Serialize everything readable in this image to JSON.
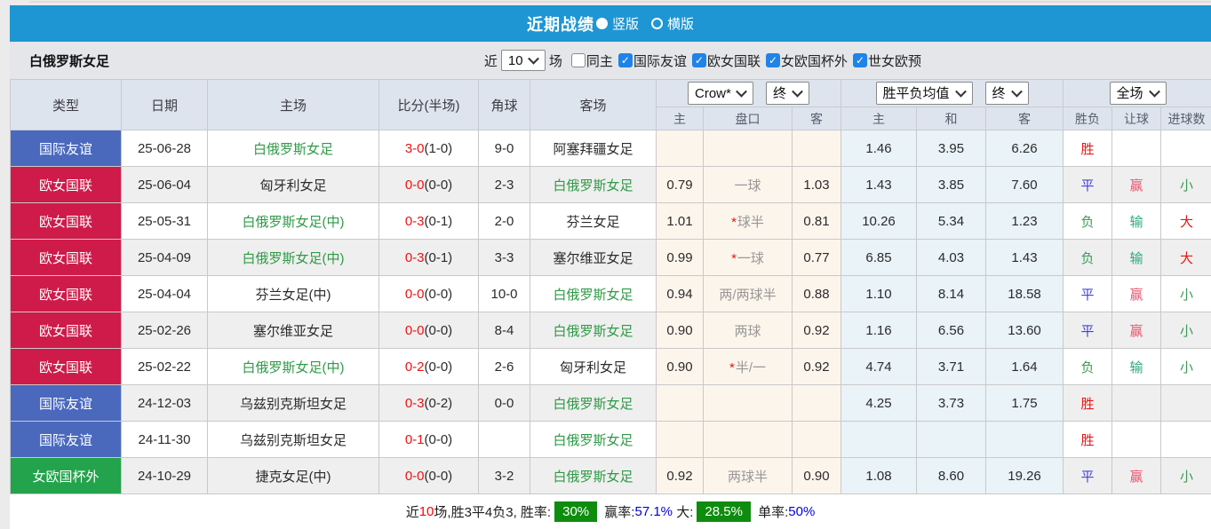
{
  "title": {
    "heading": "近期战绩",
    "radio_vertical": "竖版",
    "radio_horizontal": "横版",
    "vertical_selected": true
  },
  "team_bar": {
    "team_name": "白俄罗斯女足",
    "recent_label": "近",
    "recent_count": "10",
    "matches_label": "场",
    "checkboxes": [
      {
        "label": "同主",
        "checked": false
      },
      {
        "label": "国际友谊",
        "checked": true
      },
      {
        "label": "欧女国联",
        "checked": true
      },
      {
        "label": "女欧国杯外",
        "checked": true
      },
      {
        "label": "世女欧预",
        "checked": true
      }
    ]
  },
  "table": {
    "headers": {
      "type": "类型",
      "date": "日期",
      "home": "主场",
      "score": "比分(半场)",
      "corner": "角球",
      "away": "客场",
      "bookmaker_select": "Crow*",
      "bookmaker_time_select": "终",
      "avg_select": "胜平负均值",
      "avg_time_select": "终",
      "scope_select": "全场",
      "sub": [
        "主",
        "盘口",
        "客",
        "主",
        "和",
        "客",
        "胜负",
        "让球",
        "进球数"
      ]
    },
    "rows": [
      {
        "type": "国际友谊",
        "type_color": "blue",
        "date": "25-06-28",
        "home": "白俄罗斯女足",
        "home_green": true,
        "score": "3-0",
        "half": "(1-0)",
        "corner": "9-0",
        "away": "阿塞拜疆女足",
        "away_green": false,
        "crow_home": "",
        "handicap": "",
        "handicap_star": false,
        "crow_away": "",
        "avg_home": "1.46",
        "avg_draw": "3.95",
        "avg_away": "6.26",
        "outcome": "胜",
        "handicap_result": "",
        "goals": ""
      },
      {
        "type": "欧女国联",
        "type_color": "red",
        "date": "25-06-04",
        "home": "匈牙利女足",
        "home_green": false,
        "score": "0-0",
        "half": "(0-0)",
        "corner": "2-3",
        "away": "白俄罗斯女足",
        "away_green": true,
        "crow_home": "0.79",
        "handicap": "一球",
        "handicap_star": false,
        "crow_away": "1.03",
        "avg_home": "1.43",
        "avg_draw": "3.85",
        "avg_away": "7.60",
        "outcome": "平",
        "handicap_result": "赢",
        "goals": "小"
      },
      {
        "type": "欧女国联",
        "type_color": "red",
        "date": "25-05-31",
        "home": "白俄罗斯女足(中)",
        "home_green": true,
        "score": "0-3",
        "half": "(0-1)",
        "corner": "2-0",
        "away": "芬兰女足",
        "away_green": false,
        "crow_home": "1.01",
        "handicap": "球半",
        "handicap_star": true,
        "crow_away": "0.81",
        "avg_home": "10.26",
        "avg_draw": "5.34",
        "avg_away": "1.23",
        "outcome": "负",
        "handicap_result": "输",
        "goals": "大"
      },
      {
        "type": "欧女国联",
        "type_color": "red",
        "date": "25-04-09",
        "home": "白俄罗斯女足(中)",
        "home_green": true,
        "score": "0-3",
        "half": "(0-1)",
        "corner": "3-3",
        "away": "塞尔维亚女足",
        "away_green": false,
        "crow_home": "0.99",
        "handicap": "一球",
        "handicap_star": true,
        "crow_away": "0.77",
        "avg_home": "6.85",
        "avg_draw": "4.03",
        "avg_away": "1.43",
        "outcome": "负",
        "handicap_result": "输",
        "goals": "大"
      },
      {
        "type": "欧女国联",
        "type_color": "red",
        "date": "25-04-04",
        "home": "芬兰女足(中)",
        "home_green": false,
        "score": "0-0",
        "half": "(0-0)",
        "corner": "10-0",
        "away": "白俄罗斯女足",
        "away_green": true,
        "crow_home": "0.94",
        "handicap": "两/两球半",
        "handicap_star": false,
        "crow_away": "0.88",
        "avg_home": "1.10",
        "avg_draw": "8.14",
        "avg_away": "18.58",
        "outcome": "平",
        "handicap_result": "赢",
        "goals": "小"
      },
      {
        "type": "欧女国联",
        "type_color": "red",
        "date": "25-02-26",
        "home": "塞尔维亚女足",
        "home_green": false,
        "score": "0-0",
        "half": "(0-0)",
        "corner": "8-4",
        "away": "白俄罗斯女足",
        "away_green": true,
        "crow_home": "0.90",
        "handicap": "两球",
        "handicap_star": false,
        "crow_away": "0.92",
        "avg_home": "1.16",
        "avg_draw": "6.56",
        "avg_away": "13.60",
        "outcome": "平",
        "handicap_result": "赢",
        "goals": "小"
      },
      {
        "type": "欧女国联",
        "type_color": "red",
        "date": "25-02-22",
        "home": "白俄罗斯女足(中)",
        "home_green": true,
        "score": "0-2",
        "half": "(0-0)",
        "corner": "2-6",
        "away": "匈牙利女足",
        "away_green": false,
        "crow_home": "0.90",
        "handicap": "半/一",
        "handicap_star": true,
        "crow_away": "0.92",
        "avg_home": "4.74",
        "avg_draw": "3.71",
        "avg_away": "1.64",
        "outcome": "负",
        "handicap_result": "输",
        "goals": "小"
      },
      {
        "type": "国际友谊",
        "type_color": "blue",
        "date": "24-12-03",
        "home": "乌兹别克斯坦女足",
        "home_green": false,
        "score": "0-3",
        "half": "(0-2)",
        "corner": "0-0",
        "away": "白俄罗斯女足",
        "away_green": true,
        "crow_home": "",
        "handicap": "",
        "handicap_star": false,
        "crow_away": "",
        "avg_home": "4.25",
        "avg_draw": "3.73",
        "avg_away": "1.75",
        "outcome": "胜",
        "handicap_result": "",
        "goals": ""
      },
      {
        "type": "国际友谊",
        "type_color": "blue",
        "date": "24-11-30",
        "home": "乌兹别克斯坦女足",
        "home_green": false,
        "score": "0-1",
        "half": "(0-0)",
        "corner": "",
        "away": "白俄罗斯女足",
        "away_green": true,
        "crow_home": "",
        "handicap": "",
        "handicap_star": false,
        "crow_away": "",
        "avg_home": "",
        "avg_draw": "",
        "avg_away": "",
        "outcome": "胜",
        "handicap_result": "",
        "goals": ""
      },
      {
        "type": "女欧国杯外",
        "type_color": "green",
        "date": "24-10-29",
        "home": "捷克女足(中)",
        "home_green": false,
        "score": "0-0",
        "half": "(0-0)",
        "corner": "3-2",
        "away": "白俄罗斯女足",
        "away_green": true,
        "crow_home": "0.92",
        "handicap": "两球半",
        "handicap_star": false,
        "crow_away": "0.90",
        "avg_home": "1.08",
        "avg_draw": "8.60",
        "avg_away": "19.26",
        "outcome": "平",
        "handicap_result": "赢",
        "goals": "小"
      }
    ]
  },
  "summary": {
    "segments": [
      {
        "text": "近",
        "style": "plain"
      },
      {
        "text": "10",
        "style": "red"
      },
      {
        "text": "场,胜3平4负3, 胜率:",
        "style": "plain"
      },
      {
        "text": "30%",
        "style": "badge"
      },
      {
        "text": " 赢率:",
        "style": "plain"
      },
      {
        "text": "57.1%",
        "style": "blue"
      },
      {
        "text": " 大:",
        "style": "plain"
      },
      {
        "text": "28.5%",
        "style": "badge"
      },
      {
        "text": " 单率:",
        "style": "plain"
      },
      {
        "text": "50%",
        "style": "blue"
      }
    ]
  },
  "colors": {
    "title_bar": "#1e96d3",
    "badge_friendly_blue": "#4a69bd",
    "badge_league_red": "#ce1b4a",
    "badge_cup_green": "#23a34b",
    "team_green": "#2e9a46",
    "score_red": "#ee1111",
    "odds_cream_bg": "#fcf5ec",
    "avg_blue_bg": "#e9f3f8",
    "summary_badge_green": "#0e8c0e",
    "summary_blue": "#0000dd",
    "checkbox_blue": "#1f83e8"
  }
}
